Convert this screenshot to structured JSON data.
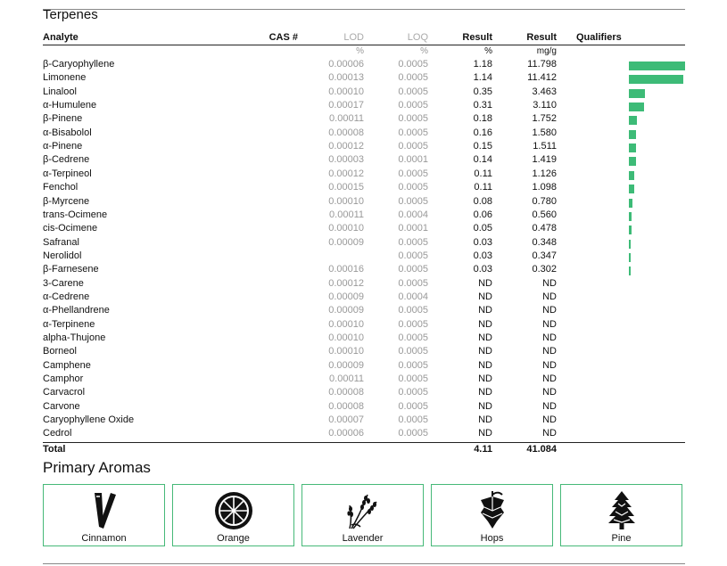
{
  "terpenes": {
    "title": "Terpenes",
    "columns": {
      "analyte": "Analyte",
      "cas": "CAS #",
      "lod": "LOD",
      "loq": "LOQ",
      "result_pct": "Result",
      "result_mg": "Result",
      "qualifiers": "Qualifiers"
    },
    "units": {
      "lod": "%",
      "loq": "%",
      "result_pct": "%",
      "result_mg": "mg/g"
    },
    "bar_color": "#3dbb77",
    "rows": [
      {
        "name": "β-Caryophyllene",
        "lod": "0.00006",
        "loq": "0.0005",
        "pct": "1.18",
        "mg": "11.798",
        "level": 11.798
      },
      {
        "name": "Limonene",
        "lod": "0.00013",
        "loq": "0.0005",
        "pct": "1.14",
        "mg": "11.412",
        "level": 11.412
      },
      {
        "name": "Linalool",
        "lod": "0.00010",
        "loq": "0.0005",
        "pct": "0.35",
        "mg": "3.463",
        "level": 3.463
      },
      {
        "name": "α-Humulene",
        "lod": "0.00017",
        "loq": "0.0005",
        "pct": "0.31",
        "mg": "3.110",
        "level": 3.11
      },
      {
        "name": "β-Pinene",
        "lod": "0.00011",
        "loq": "0.0005",
        "pct": "0.18",
        "mg": "1.752",
        "level": 1.752
      },
      {
        "name": "α-Bisabolol",
        "lod": "0.00008",
        "loq": "0.0005",
        "pct": "0.16",
        "mg": "1.580",
        "level": 1.58
      },
      {
        "name": "α-Pinene",
        "lod": "0.00012",
        "loq": "0.0005",
        "pct": "0.15",
        "mg": "1.511",
        "level": 1.511
      },
      {
        "name": "β-Cedrene",
        "lod": "0.00003",
        "loq": "0.0001",
        "pct": "0.14",
        "mg": "1.419",
        "level": 1.419
      },
      {
        "name": "α-Terpineol",
        "lod": "0.00012",
        "loq": "0.0005",
        "pct": "0.11",
        "mg": "1.126",
        "level": 1.126
      },
      {
        "name": "Fenchol",
        "lod": "0.00015",
        "loq": "0.0005",
        "pct": "0.11",
        "mg": "1.098",
        "level": 1.098
      },
      {
        "name": "β-Myrcene",
        "lod": "0.00010",
        "loq": "0.0005",
        "pct": "0.08",
        "mg": "0.780",
        "level": 0.78
      },
      {
        "name": "trans-Ocimene",
        "lod": "0.00011",
        "loq": "0.0004",
        "pct": "0.06",
        "mg": "0.560",
        "level": 0.56
      },
      {
        "name": "cis-Ocimene",
        "lod": "0.00010",
        "loq": "0.0001",
        "pct": "0.05",
        "mg": "0.478",
        "level": 0.478
      },
      {
        "name": "Safranal",
        "lod": "0.00009",
        "loq": "0.0005",
        "pct": "0.03",
        "mg": "0.348",
        "level": 0.348
      },
      {
        "name": "Nerolidol",
        "lod": "",
        "loq": "0.0005",
        "pct": "0.03",
        "mg": "0.347",
        "level": 0.347
      },
      {
        "name": "β-Farnesene",
        "lod": "0.00016",
        "loq": "0.0005",
        "pct": "0.03",
        "mg": "0.302",
        "level": 0.302
      },
      {
        "name": "3-Carene",
        "lod": "0.00012",
        "loq": "0.0005",
        "pct": "ND",
        "mg": "ND",
        "level": 0
      },
      {
        "name": "α-Cedrene",
        "lod": "0.00009",
        "loq": "0.0004",
        "pct": "ND",
        "mg": "ND",
        "level": 0
      },
      {
        "name": "α-Phellandrene",
        "lod": "0.00009",
        "loq": "0.0005",
        "pct": "ND",
        "mg": "ND",
        "level": 0
      },
      {
        "name": "α-Terpinene",
        "lod": "0.00010",
        "loq": "0.0005",
        "pct": "ND",
        "mg": "ND",
        "level": 0
      },
      {
        "name": "alpha-Thujone",
        "lod": "0.00010",
        "loq": "0.0005",
        "pct": "ND",
        "mg": "ND",
        "level": 0
      },
      {
        "name": "Borneol",
        "lod": "0.00010",
        "loq": "0.0005",
        "pct": "ND",
        "mg": "ND",
        "level": 0
      },
      {
        "name": "Camphene",
        "lod": "0.00009",
        "loq": "0.0005",
        "pct": "ND",
        "mg": "ND",
        "level": 0
      },
      {
        "name": "Camphor",
        "lod": "0.00011",
        "loq": "0.0005",
        "pct": "ND",
        "mg": "ND",
        "level": 0
      },
      {
        "name": "Carvacrol",
        "lod": "0.00008",
        "loq": "0.0005",
        "pct": "ND",
        "mg": "ND",
        "level": 0
      },
      {
        "name": "Carvone",
        "lod": "0.00008",
        "loq": "0.0005",
        "pct": "ND",
        "mg": "ND",
        "level": 0
      },
      {
        "name": "Caryophyllene Oxide",
        "lod": "0.00007",
        "loq": "0.0005",
        "pct": "ND",
        "mg": "ND",
        "level": 0
      },
      {
        "name": "Cedrol",
        "lod": "0.00006",
        "loq": "0.0005",
        "pct": "ND",
        "mg": "ND",
        "level": 0
      }
    ],
    "total": {
      "label": "Total",
      "pct": "4.11",
      "mg": "41.084"
    }
  },
  "aromas": {
    "title": "Primary Aromas",
    "border_color": "#46b978",
    "items": [
      {
        "label": "Cinnamon",
        "icon": "cinnamon-icon"
      },
      {
        "label": "Orange",
        "icon": "orange-icon"
      },
      {
        "label": "Lavender",
        "icon": "lavender-icon"
      },
      {
        "label": "Hops",
        "icon": "hops-icon"
      },
      {
        "label": "Pine",
        "icon": "pine-icon"
      }
    ]
  }
}
